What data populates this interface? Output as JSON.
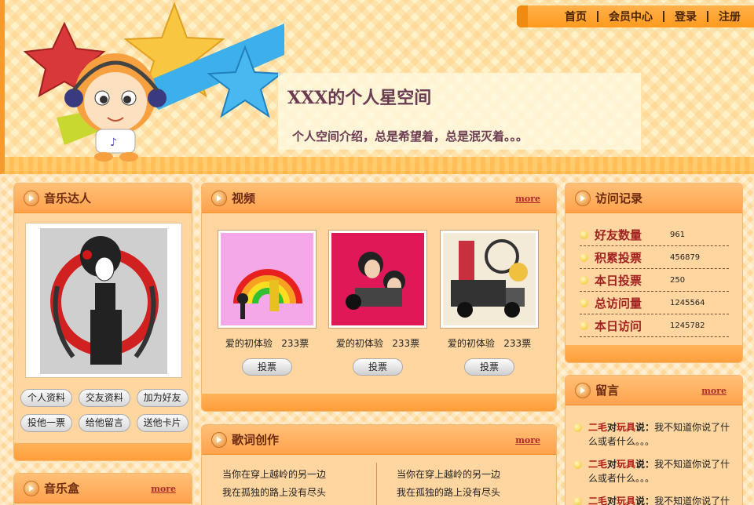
{
  "nav": {
    "items": [
      {
        "label": "首页"
      },
      {
        "label": "会员中心"
      },
      {
        "label": "登录"
      },
      {
        "label": "注册"
      }
    ]
  },
  "header": {
    "title": "XXX的个人星空间",
    "description": "个人空间介绍，总是希望着，总是泯灭着。。。"
  },
  "music_panel": {
    "title": "音乐达人",
    "buttons": [
      {
        "label": "个人资料"
      },
      {
        "label": "交友资料"
      },
      {
        "label": "加为好友"
      },
      {
        "label": "投他一票"
      },
      {
        "label": "给他留言"
      },
      {
        "label": "送他卡片"
      }
    ]
  },
  "musicbox_panel": {
    "title": "音乐盒",
    "more": "more"
  },
  "video_panel": {
    "title": "视频",
    "more": "more",
    "items": [
      {
        "caption": "爱的初体验",
        "votes": "233票",
        "vote_label": "投票"
      },
      {
        "caption": "爱的初体验",
        "votes": "233票",
        "vote_label": "投票"
      },
      {
        "caption": "爱的初体验",
        "votes": "233票",
        "vote_label": "投票"
      }
    ]
  },
  "lyrics_panel": {
    "title": "歌词创作",
    "more": "more",
    "columns": [
      [
        "当你在穿上越岭的另一边",
        "我在孤独的路上没有尽头"
      ],
      [
        "当你在穿上越岭的另一边",
        "我在孤独的路上没有尽头"
      ]
    ]
  },
  "visits_panel": {
    "title": "访问记录",
    "stats": [
      {
        "label": "好友数量",
        "value": "961"
      },
      {
        "label": "积累投票",
        "value": "456879"
      },
      {
        "label": "本日投票",
        "value": "250"
      },
      {
        "label": "总访问量",
        "value": "1245564"
      },
      {
        "label": "本日访问",
        "value": "1245782"
      }
    ]
  },
  "messages_panel": {
    "title": "留言",
    "more": "more",
    "items": [
      {
        "name": "二毛",
        "to": "对",
        "target": "玩具",
        "said": "说：",
        "text": "我不知道你说了什么或者什么。。。"
      },
      {
        "name": "二毛",
        "to": "对",
        "target": "玩具",
        "said": "说：",
        "text": "我不知道你说了什么或者什么。。。"
      },
      {
        "name": "二毛",
        "to": "对",
        "target": "玩具",
        "said": "说：",
        "text": "我不知道你说了什么或者什么。。。"
      }
    ]
  }
}
